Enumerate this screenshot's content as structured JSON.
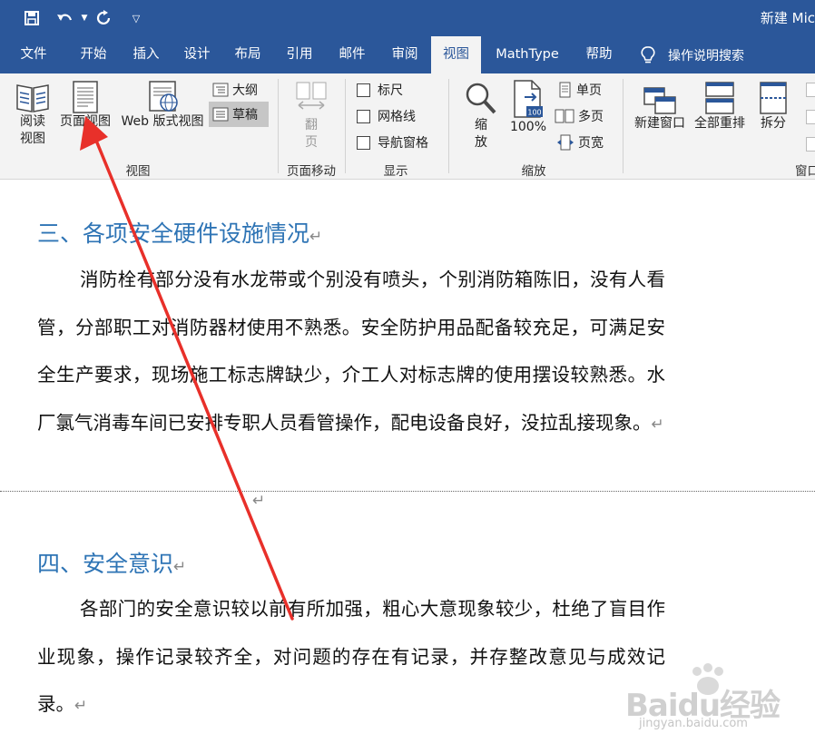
{
  "title_bar": {
    "doc_title": "新建 Mic"
  },
  "tabs": [
    "文件",
    "开始",
    "插入",
    "设计",
    "布局",
    "引用",
    "邮件",
    "审阅",
    "视图",
    "MathType",
    "帮助"
  ],
  "active_tab": "视图",
  "tell_me": "操作说明搜索",
  "ribbon": {
    "views": {
      "read_mode_1": "阅读",
      "read_mode_2": "视图",
      "print_layout": "页面视图",
      "web_layout": "Web 版式视图",
      "outline": "大纲",
      "draft": "草稿",
      "group_label": "视图"
    },
    "page_move": {
      "flip_1": "翻",
      "flip_2": "页",
      "group_label": "页面移动"
    },
    "show": {
      "ruler": "标尺",
      "gridlines": "网格线",
      "nav_pane": "导航窗格",
      "group_label": "显示"
    },
    "zoom": {
      "zoom_1": "缩",
      "zoom_2": "放",
      "hundred": "100%",
      "one_page": "单页",
      "multi_page": "多页",
      "page_width": "页宽",
      "group_label": "缩放"
    },
    "window": {
      "new_window": "新建窗口",
      "arrange_all": "全部重排",
      "split": "拆分",
      "group_label": "窗口"
    }
  },
  "document": {
    "heading3": "三、各项安全硬件设施情况",
    "para1": "消防栓有部分没有水龙带或个别没有喷头，个别消防箱陈旧，没有人看管，分部职工对消防器材使用不熟悉。安全防护用品配备较充足，可满足安全生产要求，现场施工标志牌缺少，介工人对标志牌的使用摆设较熟悉。水厂氯气消毒车间已安排专职人员看管操作，配电设备良好，没拉乱接现象。",
    "heading4": "四、安全意识",
    "para2": "各部门的安全意识较以前有所加强，粗心大意现象较少，杜绝了盲目作业现象，操作记录较齐全，对问题的存在有记录，并存整改意见与成效记录。",
    "para_mark": "↵"
  },
  "watermark": {
    "brand": "Baidu经验",
    "url": "jingyan.baidu.com"
  },
  "colors": {
    "brand_blue": "#2b579a",
    "heading_blue": "#2e74b5",
    "annotation_red": "#e8302a"
  }
}
